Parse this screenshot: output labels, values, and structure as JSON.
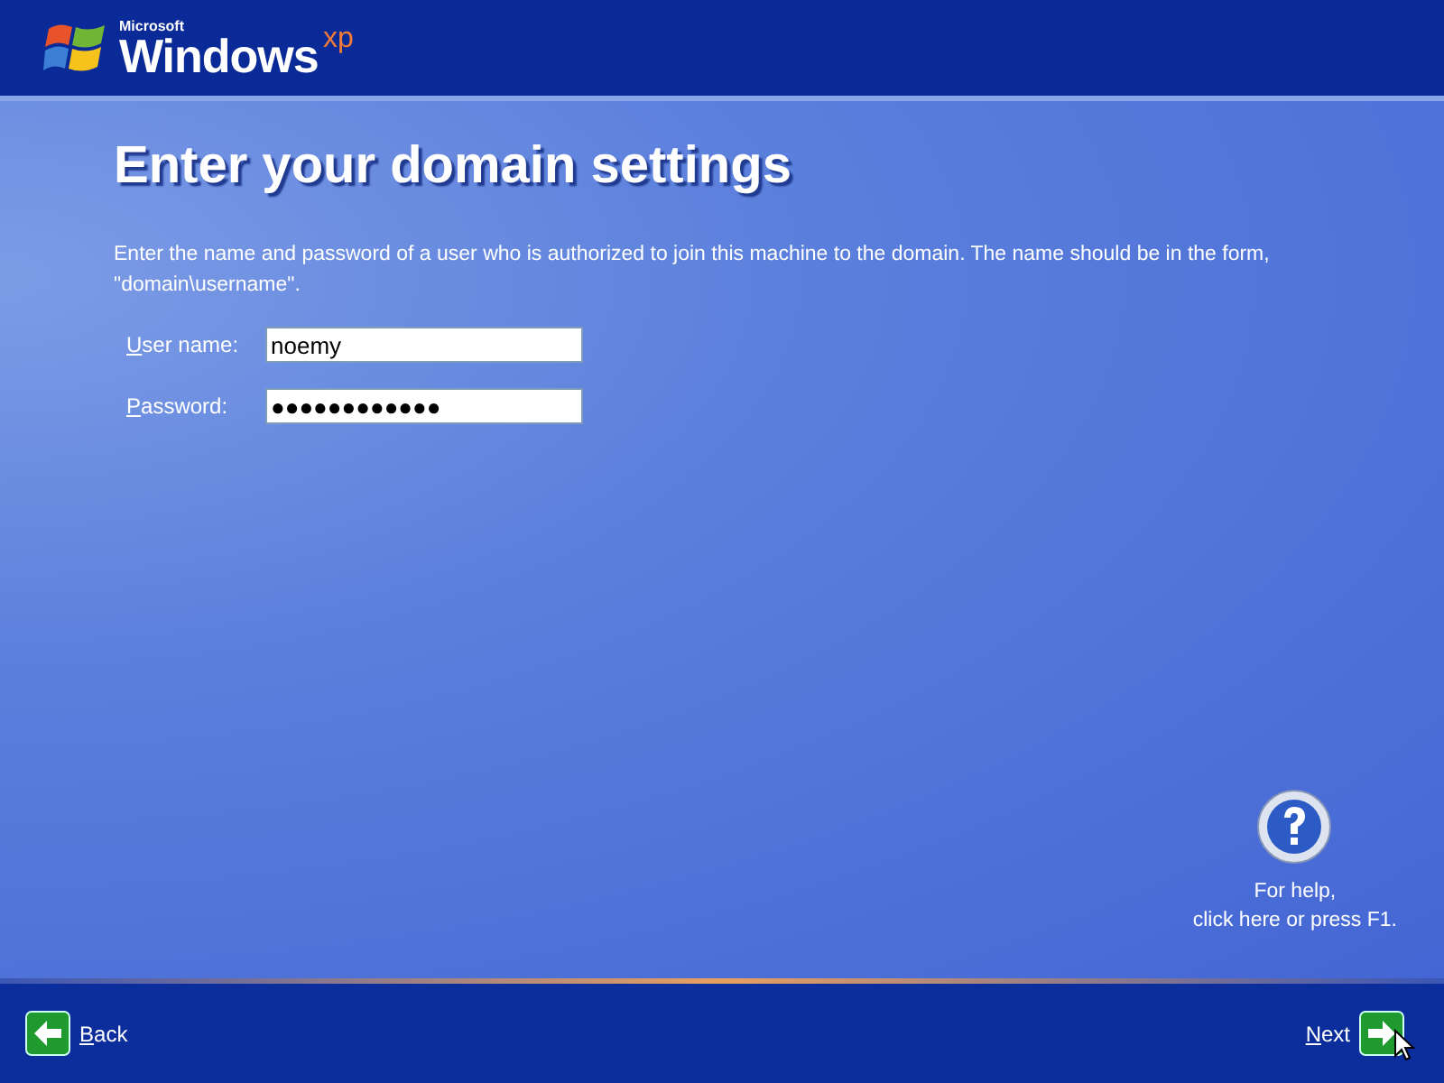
{
  "logo": {
    "company": "Microsoft",
    "product": "Windows",
    "edition": "xp"
  },
  "title": "Enter your domain settings",
  "instructions": "Enter the name and password of a user who is authorized to join this machine to the domain. The name should be in the form, \"domain\\username\".",
  "fields": [
    {
      "label": "User name:",
      "value": "noemy"
    },
    {
      "label": "Password:",
      "value": "●●●●●●●●●●●●"
    }
  ],
  "help": {
    "line_1": "For help,",
    "line_2": "click here or press F1."
  },
  "footer": {
    "back": "Back",
    "next": "Next"
  }
}
